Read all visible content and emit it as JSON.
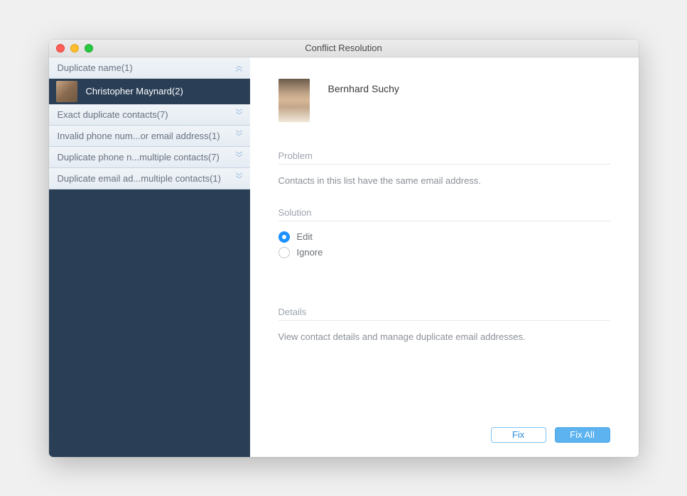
{
  "window": {
    "title": "Conflict Resolution"
  },
  "sidebar": {
    "categories": [
      {
        "label": "Duplicate name(1)",
        "expanded": true
      },
      {
        "label": "Exact duplicate contacts(7)",
        "expanded": false
      },
      {
        "label": "Invalid phone num...or email address(1)",
        "expanded": false
      },
      {
        "label": "Duplicate phone n...multiple contacts(7)",
        "expanded": false
      },
      {
        "label": "Duplicate email ad...multiple contacts(1)",
        "expanded": false
      }
    ],
    "selected_item": {
      "label": "Christopher Maynard(2)"
    }
  },
  "main": {
    "contact_name": "Bernhard Suchy",
    "problem": {
      "title": "Problem",
      "text": "Contacts in this list have the same email address."
    },
    "solution": {
      "title": "Solution",
      "options": [
        {
          "label": "Edit",
          "selected": true
        },
        {
          "label": "Ignore",
          "selected": false
        }
      ]
    },
    "details": {
      "title": "Details",
      "text": "View contact details and manage duplicate email addresses."
    },
    "buttons": {
      "fix": "Fix",
      "fix_all": "Fix All"
    }
  }
}
